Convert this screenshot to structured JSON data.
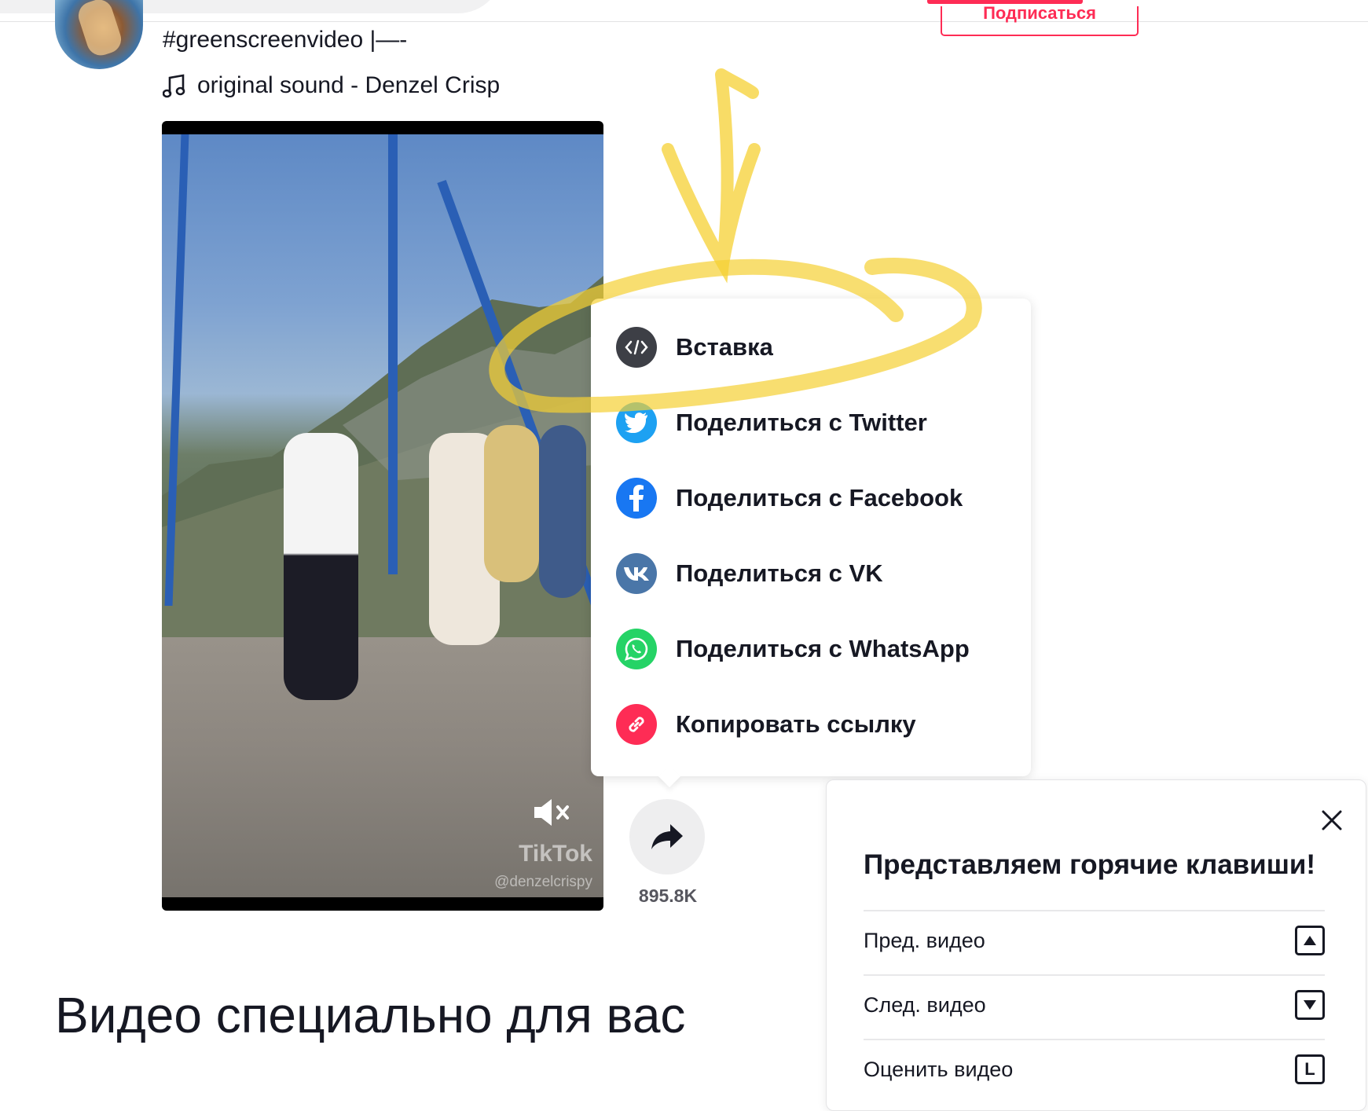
{
  "header": {
    "follow_label": "Подписаться"
  },
  "post": {
    "caption": "#greenscreenvideo |—-",
    "sound": "original sound - Denzel Crisp",
    "watermark": "TikTok",
    "watermark_user": "@denzelcrispy"
  },
  "actions": {
    "share_count": "895.8K"
  },
  "share_menu": {
    "items": [
      {
        "label": "Вставка",
        "icon": "embed-icon",
        "color": "#3d3f46"
      },
      {
        "label": "Поделиться с Twitter",
        "icon": "twitter-icon",
        "color": "#1da1f2"
      },
      {
        "label": "Поделиться с Facebook",
        "icon": "facebook-icon",
        "color": "#1877f2"
      },
      {
        "label": "Поделиться с VK",
        "icon": "vk-icon",
        "color": "#4a76a8"
      },
      {
        "label": "Поделиться с WhatsApp",
        "icon": "whatsapp-icon",
        "color": "#25d366"
      },
      {
        "label": "Копировать ссылку",
        "icon": "link-icon",
        "color": "#fe2c55"
      }
    ]
  },
  "hotkeys": {
    "title": "Представляем горячие клавиши!",
    "rows": [
      {
        "label": "Пред. видео",
        "key": "up-arrow-key"
      },
      {
        "label": "След. видео",
        "key": "down-arrow-key"
      },
      {
        "label": "Оценить видео",
        "key": "L"
      }
    ]
  },
  "section": {
    "title": "Видео специально для вас"
  },
  "colors": {
    "accent": "#fe2c55",
    "highlight": "#f5d033"
  }
}
